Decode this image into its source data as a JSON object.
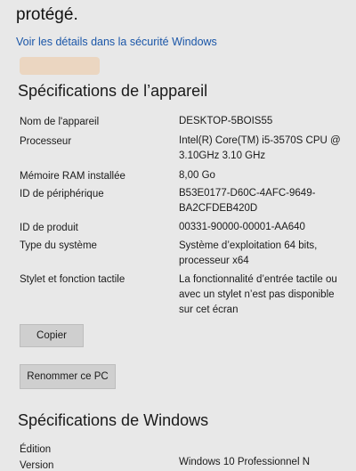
{
  "header": {
    "protected_text": "protégé.",
    "security_link": "Voir les détails dans la sécurité Windows"
  },
  "device": {
    "title": "Spécifications de l’appareil",
    "rows": [
      {
        "label": "Nom de l'appareil",
        "value": [
          "DESKTOP-5BOIS55"
        ]
      },
      {
        "label": "Processeur",
        "value": [
          "Intel(R) Core(TM) i5-3570S CPU @",
          "3.10GHz  3.10 GHz"
        ]
      },
      {
        "label": "Mémoire RAM installée",
        "value": [
          "8,00 Go"
        ]
      },
      {
        "label": "ID de périphérique",
        "value": [
          "B53E0177-D60C-4AFC-9649-",
          "BA2CFDEB420D"
        ]
      },
      {
        "label": "ID de produit",
        "value": [
          "00331-90000-00001-AA640"
        ]
      },
      {
        "label": "Type du système",
        "value": [
          "Système d’exploitation 64 bits,",
          "processeur x64"
        ]
      },
      {
        "label": "Stylet et fonction tactile",
        "value": [
          "La fonctionnalité d’entrée tactile ou",
          "avec un stylet n’est pas disponible",
          "sur cet écran"
        ]
      }
    ],
    "copy_button": "Copier",
    "rename_button": "Renommer ce PC"
  },
  "windows": {
    "title": "Spécifications de Windows",
    "rows": [
      {
        "label": "Édition",
        "value": [
          "Windows 10 Professionnel N"
        ]
      },
      {
        "label": "Version",
        "value": [
          ""
        ]
      }
    ]
  }
}
